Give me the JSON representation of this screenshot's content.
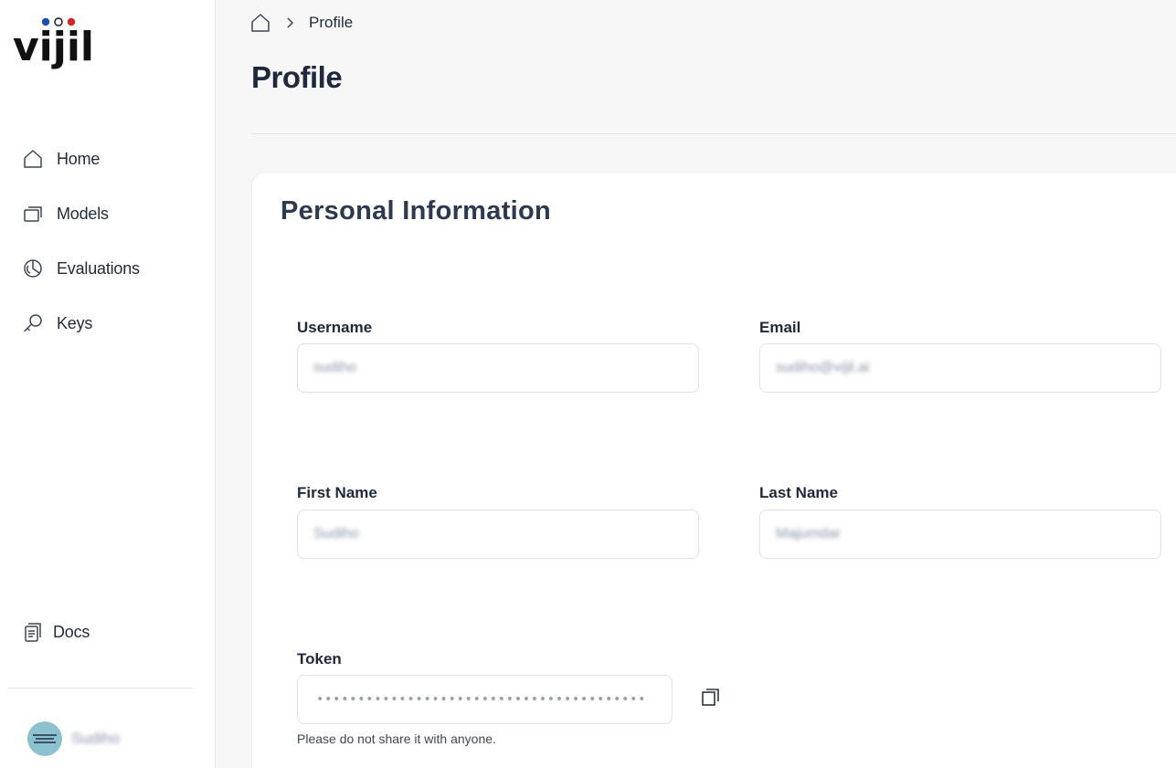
{
  "brand": {
    "logo_text": "vijil",
    "dot_colors": [
      "#1c4fb0",
      "#ffffff",
      "#d4242a"
    ]
  },
  "sidebar": {
    "items": [
      {
        "label": "Home",
        "icon": "home-icon"
      },
      {
        "label": "Models",
        "icon": "models-icon"
      },
      {
        "label": "Evaluations",
        "icon": "evaluations-icon"
      },
      {
        "label": "Keys",
        "icon": "key-icon"
      }
    ],
    "docs": {
      "label": "Docs",
      "icon": "docs-icon"
    },
    "user": {
      "name": "Sudiho"
    }
  },
  "breadcrumb": {
    "current": "Profile"
  },
  "page": {
    "title": "Profile"
  },
  "personal_info": {
    "title": "Personal Information",
    "username": {
      "label": "Username",
      "value": "sudiho"
    },
    "email": {
      "label": "Email",
      "value": "sudiho@vijil.ai"
    },
    "first_name": {
      "label": "First Name",
      "value": "Sudiho"
    },
    "last_name": {
      "label": "Last Name",
      "value": "Majumdar"
    },
    "token": {
      "label": "Token",
      "masked_value": "••••••••••••••••••••••••••••••••••••••••",
      "hint": "Please do not share it with anyone."
    }
  },
  "colors": {
    "text_primary": "#1e2a3b",
    "border": "#dfe2e7",
    "page_bg": "#f7f7f7",
    "avatar_bg": "#8cc1d0"
  }
}
